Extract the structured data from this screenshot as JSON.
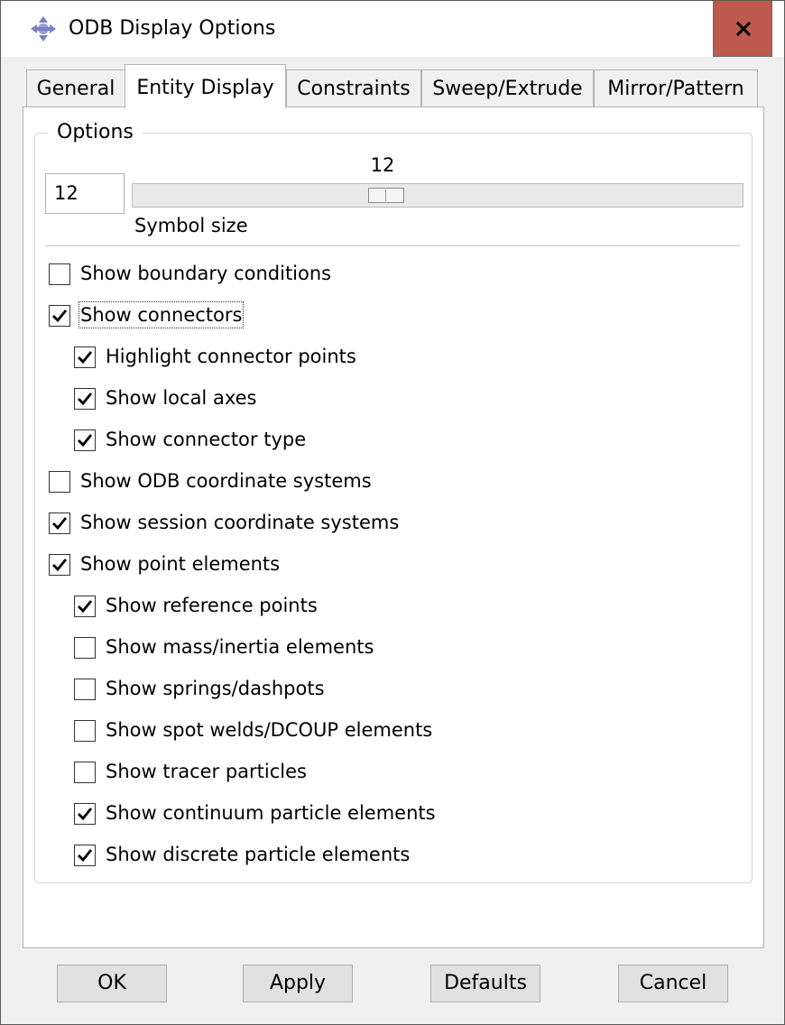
{
  "window": {
    "title": "ODB Display Options",
    "close_label": "x"
  },
  "tabs": [
    {
      "label": "General",
      "active": false
    },
    {
      "label": "Entity Display",
      "active": true
    },
    {
      "label": "Constraints",
      "active": false
    },
    {
      "label": "Sweep/Extrude",
      "active": false
    },
    {
      "label": "Mirror/Pattern",
      "active": false
    }
  ],
  "options": {
    "group_label": "Options",
    "symbol_size_value": "12",
    "slider_value_label": "12",
    "slider_value": 12,
    "slider_fraction": 0.41,
    "symbol_size_caption": "Symbol size"
  },
  "checkboxes": [
    {
      "label": "Show boundary conditions",
      "checked": false,
      "indent": 0
    },
    {
      "label": "Show connectors",
      "checked": true,
      "indent": 0,
      "focused": true
    },
    {
      "label": "Highlight connector points",
      "checked": true,
      "indent": 1
    },
    {
      "label": "Show local axes",
      "checked": true,
      "indent": 1
    },
    {
      "label": "Show connector type",
      "checked": true,
      "indent": 1
    },
    {
      "label": "Show ODB coordinate systems",
      "checked": false,
      "indent": 0
    },
    {
      "label": "Show session coordinate systems",
      "checked": true,
      "indent": 0
    },
    {
      "label": "Show point elements",
      "checked": true,
      "indent": 0
    },
    {
      "label": "Show reference points",
      "checked": true,
      "indent": 1
    },
    {
      "label": "Show mass/inertia elements",
      "checked": false,
      "indent": 1
    },
    {
      "label": "Show springs/dashpots",
      "checked": false,
      "indent": 1
    },
    {
      "label": "Show spot welds/DCOUP elements",
      "checked": false,
      "indent": 1
    },
    {
      "label": "Show tracer particles",
      "checked": false,
      "indent": 1
    },
    {
      "label": "Show continuum particle elements",
      "checked": true,
      "indent": 1
    },
    {
      "label": "Show discrete particle elements",
      "checked": true,
      "indent": 1
    }
  ],
  "buttons": {
    "ok": "OK",
    "apply": "Apply",
    "defaults": "Defaults",
    "cancel": "Cancel"
  },
  "colors": {
    "close_button": "#bf5a4e",
    "title_icon": "#7b7fc4"
  },
  "icons": {
    "title": "abaqus-app-icon",
    "check": "check-mark-icon"
  }
}
